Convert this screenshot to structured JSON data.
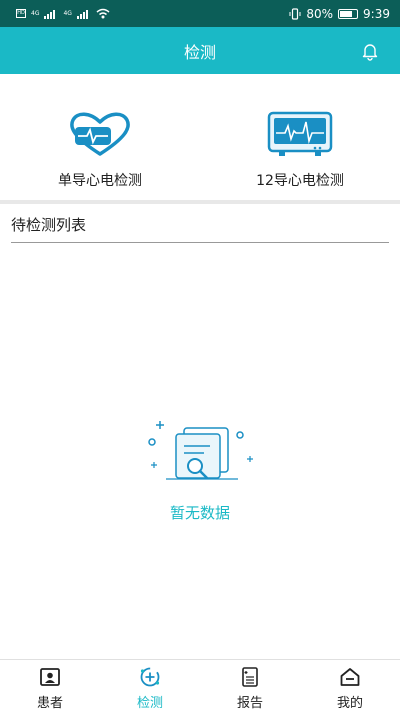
{
  "status_bar": {
    "left_indicators": [
      "HD",
      "4G",
      "4G"
    ],
    "battery": "80%",
    "battery_level": 0.8,
    "time": "9:39"
  },
  "header": {
    "title": "检测"
  },
  "devices": [
    {
      "label": "单导心电检测",
      "icon": "heart-ecg-icon"
    },
    {
      "label": "12导心电检测",
      "icon": "ecg-monitor-icon"
    }
  ],
  "pending_list": {
    "title": "待检测列表",
    "empty_text": "暂无数据"
  },
  "tabs": [
    {
      "label": "患者",
      "icon": "patient-icon",
      "active": false
    },
    {
      "label": "检测",
      "icon": "detect-icon",
      "active": true
    },
    {
      "label": "报告",
      "icon": "report-icon",
      "active": false
    },
    {
      "label": "我的",
      "icon": "home-icon",
      "active": false
    }
  ],
  "colors": {
    "status_bar": "#0c5e58",
    "accent": "#1ab9c6",
    "divider": "#e8e8e8"
  }
}
